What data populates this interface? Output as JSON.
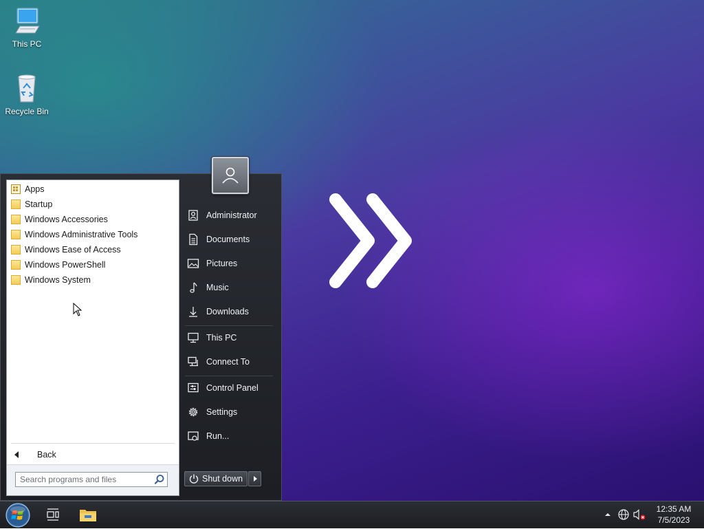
{
  "desktop": {
    "icons": [
      {
        "label": "This PC"
      },
      {
        "label": "Recycle Bin"
      }
    ]
  },
  "start_menu": {
    "programs": [
      {
        "label": "Apps",
        "icon": "apps-icon"
      },
      {
        "label": "Startup",
        "icon": "folder-icon"
      },
      {
        "label": "Windows Accessories",
        "icon": "folder-icon"
      },
      {
        "label": "Windows Administrative Tools",
        "icon": "folder-icon"
      },
      {
        "label": "Windows Ease of Access",
        "icon": "folder-icon"
      },
      {
        "label": "Windows PowerShell",
        "icon": "folder-icon"
      },
      {
        "label": "Windows System",
        "icon": "folder-icon"
      }
    ],
    "back_label": "Back",
    "search": {
      "placeholder": "Search programs and files",
      "value": ""
    },
    "right_items": [
      {
        "label": "Administrator",
        "icon": "user-icon"
      },
      {
        "label": "Documents",
        "icon": "document-icon"
      },
      {
        "label": "Pictures",
        "icon": "picture-icon"
      },
      {
        "label": "Music",
        "icon": "music-icon"
      },
      {
        "label": "Downloads",
        "icon": "download-icon"
      },
      {
        "label": "This PC",
        "icon": "computer-icon"
      },
      {
        "label": "Connect To",
        "icon": "connect-icon"
      },
      {
        "label": "Control Panel",
        "icon": "control-panel-icon"
      },
      {
        "label": "Settings",
        "icon": "gear-icon"
      },
      {
        "label": "Run...",
        "icon": "run-icon"
      }
    ],
    "shutdown_label": "Shut down"
  },
  "taskbar": {
    "clock_time": "12:35 AM",
    "clock_date": "7/5/2023"
  },
  "colors": {
    "desktop_teal": "#2c7c86",
    "desktop_purple": "#3c1f8e",
    "menu_dark": "#1c1e23",
    "folder_yellow": "#f4cc58"
  }
}
